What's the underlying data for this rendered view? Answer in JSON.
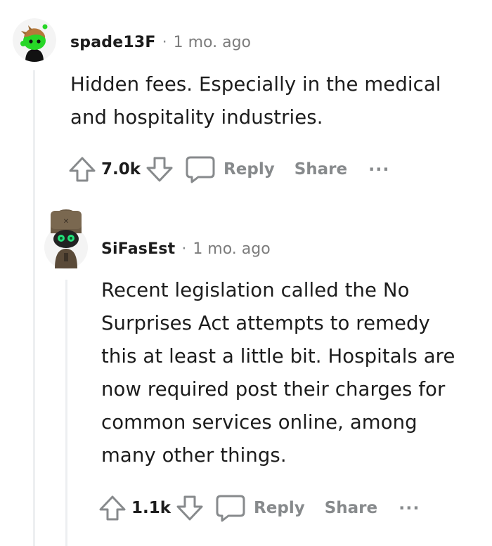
{
  "comments": [
    {
      "username": "spade13F",
      "separator": "·",
      "time": "1 mo. ago",
      "body_lines": [
        "Hidden fees. Especially in the medical",
        "and hospitality industries."
      ],
      "score": "7.0k",
      "reply_label": "Reply",
      "share_label": "Share",
      "more_label": "···",
      "avatar_icon": "snoo-avatar-green",
      "colors": {
        "avatar": "#27d627"
      }
    },
    {
      "username": "SiFasEst",
      "separator": "·",
      "time": "1 mo. ago",
      "body_lines": [
        "Recent legislation called the No",
        "Surprises Act attempts to remedy",
        "this at least a little bit. Hospitals are",
        "now required post their charges for",
        "common services online, among",
        "many other things."
      ],
      "score": "1.1k",
      "reply_label": "Reply",
      "share_label": "Share",
      "more_label": "···",
      "avatar_icon": "snoo-avatar-goggles",
      "colors": {
        "avatar": "#6b5a44"
      }
    }
  ],
  "icons": {
    "upvote": "arrow-up-icon",
    "downvote": "arrow-down-icon",
    "reply": "speech-bubble-icon"
  }
}
